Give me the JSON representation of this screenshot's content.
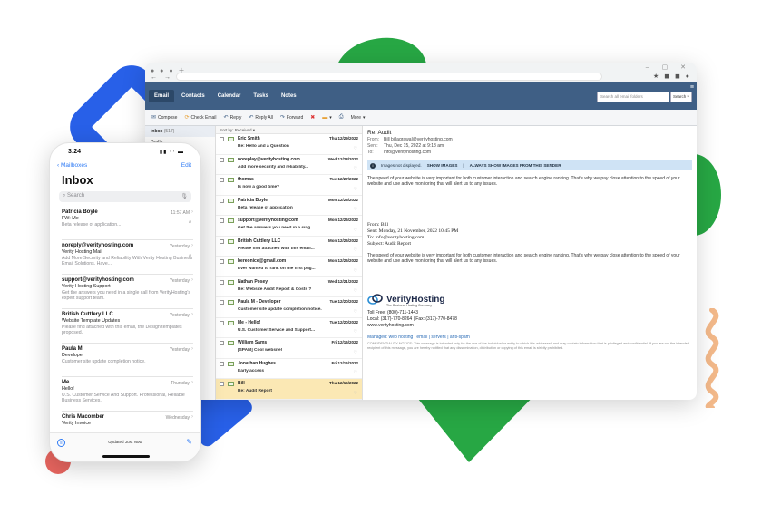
{
  "colors": {
    "accent": "#2f7bf5",
    "appbar": "#3f5f85",
    "selected_row": "#fbe8b4",
    "brand_green": "#27a744",
    "brand_blue": "#2860e8"
  },
  "desktop": {
    "tabs": [
      "Email",
      "Contacts",
      "Calendar",
      "Tasks",
      "Notes"
    ],
    "search_placeholder": "Search all email folders",
    "search_button": "Search",
    "toolbar": {
      "compose": "Compose",
      "check": "Check Email",
      "reply": "Reply",
      "reply_all": "Reply All",
      "forward": "Forward",
      "more": "More"
    },
    "folders": [
      {
        "name": "Inbox",
        "count": "(517)"
      },
      {
        "name": "Drafts",
        "count": ""
      }
    ],
    "sort_label": "Sort by: Received",
    "messages": [
      {
        "from": "Eric Smith",
        "date": "Thu 12/29/2022",
        "subject": "Re: Hello and a Question"
      },
      {
        "from": "noreplay@verityhosting.com",
        "date": "Wed 12/28/2022",
        "subject": "Add more security and reliability..."
      },
      {
        "from": "thomas",
        "date": "Tue 12/27/2022",
        "subject": "Is now a good time?"
      },
      {
        "from": "Patricia Boyle",
        "date": "Mon 12/26/2022",
        "subject": "Beta release of application"
      },
      {
        "from": "support@verityhosting.com",
        "date": "Mon 12/26/2022",
        "subject": "Get the answers you need in a sing..."
      },
      {
        "from": "British Cuttlery LLC",
        "date": "Mon 12/26/2022",
        "subject": "Please find attached with this email..."
      },
      {
        "from": "bereonice@gmail.com",
        "date": "Mon 12/26/2022",
        "subject": "Ever wanted to rank on the first pag..."
      },
      {
        "from": "Nathan Posey",
        "date": "Wed 12/21/2022",
        "subject": "Re: Website Audit Report & Costs ?"
      },
      {
        "from": "Paula M - Developer",
        "date": "Tue 12/20/2022",
        "subject": "Customer site update completion notice."
      },
      {
        "from": "Me - Hello!",
        "date": "Tue 12/20/2022",
        "subject": "U.S. Customer Service and Support..."
      },
      {
        "from": "William Sams",
        "date": "Fri 12/16/2022",
        "subject": "[SPAM] Cool website!"
      },
      {
        "from": "Jonathan Hughes",
        "date": "Fri 12/16/2022",
        "subject": "Early access"
      },
      {
        "from": "Bill",
        "date": "Thu 12/15/2022",
        "subject": "Re: Audit Report"
      }
    ],
    "reader": {
      "title": "Re: Audit",
      "from_k": "From:",
      "from_v": "Bill  billagrawal@verityhosting.com",
      "sent_k": "Sent:",
      "sent_v": "Thu, Dec 15, 2022 at 9:18 am",
      "to_k": "To:",
      "to_v": "info@verityhosting.com",
      "images_notice": "Images not displayed.",
      "show_images": "SHOW IMAGES",
      "sep": "|",
      "always_show": "ALWAYS SHOW IMAGES FROM THIS SENDER",
      "body": "The speed of your website is very important for both customer interaction and search engine ranking. That's why we pay close attention to the speed of your website and use active monitoring that will alert us to any issues.",
      "quote_from": "From: Bill",
      "quote_sent": "Sent: Monday, 21 November, 2022 10:45 PM",
      "quote_to": "To: info@verityhosting.com",
      "quote_subject": "Subject: Audit Report",
      "body2": "The speed of your website is very important for both customer interaction and search engine ranking. That's why we pay close attention to the speed of your website and use active monitoring that will alert us to any issues.",
      "brand_name": "VerityHosting",
      "brand_tag": "The Business Hosting Company",
      "toll_free": "Toll Free: (800)-711-1443",
      "local": "Local: (317)-770-8264 | Fax: (317)-770-8478",
      "website": "www.verityhosting.com",
      "managed": "Managed: web hosting | email | servers | anti-spam",
      "confidential": "CONFIDENTIALITY NOTICE: This message is intended only for the use of the individual or entity to which it is addressed and may contain information that is privileged and confidential. If you are not the intended recipient of this message, you are hereby notified that any dissemination, distribution or copying of this email is strictly prohibited."
    }
  },
  "phone": {
    "time": "3:24",
    "back": "Mailboxes",
    "edit": "Edit",
    "title": "Inbox",
    "search": "Search",
    "items": [
      {
        "from": "Patricia Boyle",
        "when": "11:57 AM",
        "subject": "FW: Me",
        "preview": "Beta release of application..."
      },
      {
        "from": "noreply@verityhosting.com",
        "when": "Yesterday",
        "subject": "Verity Hosting Mail",
        "preview": "Add More Security and Reliability With Verity Hosting Business Email Solutions. Have..."
      },
      {
        "from": "support@verityhosting.com",
        "when": "Yesterday",
        "subject": "Verity Hosting Support",
        "preview": "Get the answers you need in a single call from VerityHosting's expert support team."
      },
      {
        "from": "British Cuttlery LLC",
        "when": "Yesterday",
        "subject": "Website Template Updates",
        "preview": "Please find attached with this email, the Design templates proposed."
      },
      {
        "from": "Paula M",
        "when": "Yesterday",
        "subject": "Developer",
        "preview": "Customer site update completion notice."
      },
      {
        "from": "Me",
        "when": "Thursday",
        "subject": "Hello!",
        "preview": "U.S. Customer Service And Support. Professional, Reliable Business Services."
      },
      {
        "from": "Chris Macomber",
        "when": "Wednesday",
        "subject": "Verity Invoice",
        "preview": ""
      }
    ],
    "updated": "Updated Just Now"
  }
}
